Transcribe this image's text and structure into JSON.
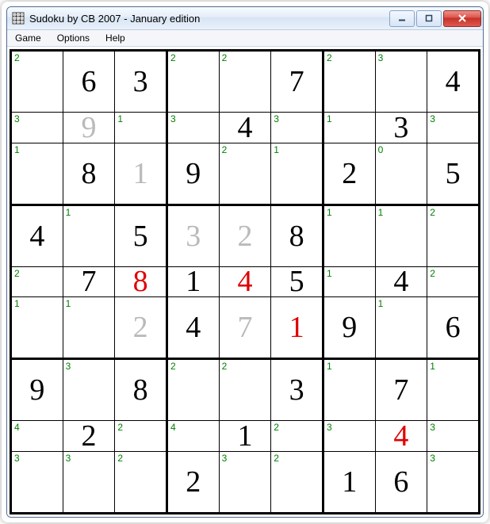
{
  "window": {
    "title": "Sudoku by CB 2007 - January edition"
  },
  "menu": {
    "game": "Game",
    "options": "Options",
    "help": "Help"
  },
  "winbtn": {
    "min": "—",
    "max": "▢",
    "close": "X"
  },
  "board": {
    "rows": [
      [
        {
          "hint": "2"
        },
        {
          "val": "6",
          "color": "black"
        },
        {
          "val": "3",
          "color": "black"
        },
        {
          "hint": "2"
        },
        {
          "hint": "2"
        },
        {
          "val": "7",
          "color": "black"
        },
        {
          "hint": "2"
        },
        {
          "hint": "3"
        },
        {
          "val": "4",
          "color": "black"
        }
      ],
      [
        {
          "hint": "3"
        },
        {
          "val": "9",
          "color": "gray"
        },
        {
          "hint": "1"
        },
        {
          "hint": "3"
        },
        {
          "val": "4",
          "color": "black"
        },
        {
          "hint": "3"
        },
        {
          "hint": "1"
        },
        {
          "val": "3",
          "color": "black"
        },
        {
          "hint": "3"
        }
      ],
      [
        {
          "hint": "1"
        },
        {
          "val": "8",
          "color": "black"
        },
        {
          "val": "1",
          "color": "gray"
        },
        {
          "val": "9",
          "color": "black"
        },
        {
          "hint": "2"
        },
        {
          "hint": "1"
        },
        {
          "val": "2",
          "color": "black"
        },
        {
          "hint": "0"
        },
        {
          "val": "5",
          "color": "black"
        }
      ],
      [
        {
          "val": "4",
          "color": "black"
        },
        {
          "hint": "1"
        },
        {
          "val": "5",
          "color": "black"
        },
        {
          "val": "3",
          "color": "gray"
        },
        {
          "val": "2",
          "color": "gray"
        },
        {
          "val": "8",
          "color": "black"
        },
        {
          "hint": "1"
        },
        {
          "hint": "1"
        },
        {
          "hint": "2"
        }
      ],
      [
        {
          "hint": "2"
        },
        {
          "val": "7",
          "color": "black"
        },
        {
          "val": "8",
          "color": "red"
        },
        {
          "val": "1",
          "color": "black"
        },
        {
          "val": "4",
          "color": "red"
        },
        {
          "val": "5",
          "color": "black"
        },
        {
          "hint": "1"
        },
        {
          "val": "4",
          "color": "black"
        },
        {
          "hint": "2"
        }
      ],
      [
        {
          "hint": "1"
        },
        {
          "hint": "1"
        },
        {
          "val": "2",
          "color": "gray"
        },
        {
          "val": "4",
          "color": "black"
        },
        {
          "val": "7",
          "color": "gray"
        },
        {
          "val": "1",
          "color": "red"
        },
        {
          "val": "9",
          "color": "black"
        },
        {
          "hint": "1"
        },
        {
          "val": "6",
          "color": "black"
        }
      ],
      [
        {
          "val": "9",
          "color": "black"
        },
        {
          "hint": "3"
        },
        {
          "val": "8",
          "color": "black"
        },
        {
          "hint": "2"
        },
        {
          "hint": "2"
        },
        {
          "val": "3",
          "color": "black"
        },
        {
          "hint": "1"
        },
        {
          "val": "7",
          "color": "black"
        },
        {
          "hint": "1"
        }
      ],
      [
        {
          "hint": "4"
        },
        {
          "val": "2",
          "color": "black"
        },
        {
          "hint": "2"
        },
        {
          "hint": "4"
        },
        {
          "val": "1",
          "color": "black"
        },
        {
          "hint": "2"
        },
        {
          "hint": "3"
        },
        {
          "val": "4",
          "color": "red"
        },
        {
          "hint": "3"
        }
      ],
      [
        {
          "hint": "3"
        },
        {
          "hint": "3"
        },
        {
          "hint": "2"
        },
        {
          "val": "2",
          "color": "black"
        },
        {
          "hint": "3"
        },
        {
          "hint": "2"
        },
        {
          "val": "1",
          "color": "black"
        },
        {
          "val": "6",
          "color": "black"
        },
        {
          "hint": "3"
        }
      ]
    ]
  }
}
